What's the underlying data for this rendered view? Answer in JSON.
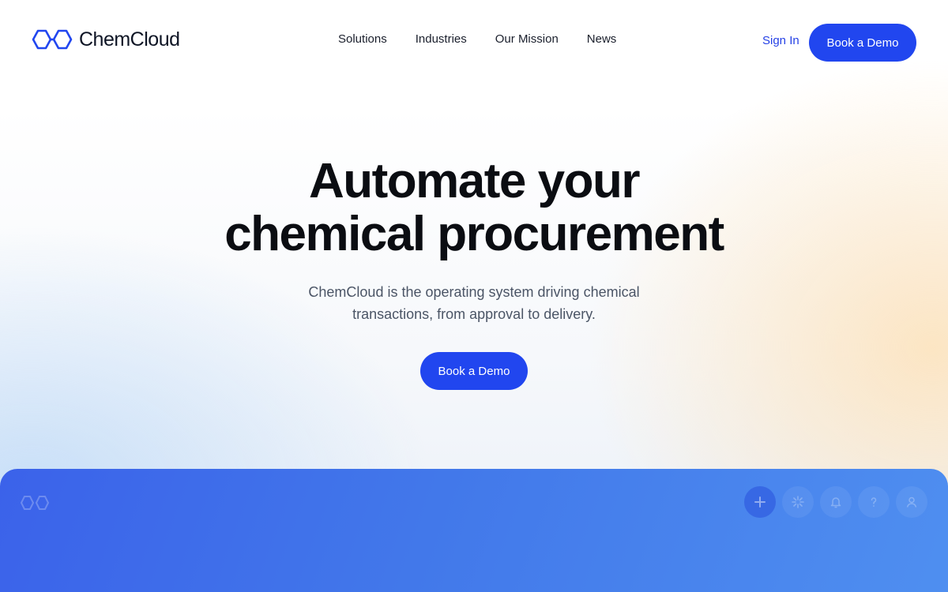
{
  "brand": {
    "name": "ChemCloud",
    "logo_icon": "hexagon-pair-icon",
    "accent_color": "#2146ef"
  },
  "nav": {
    "items": [
      {
        "label": "Solutions"
      },
      {
        "label": "Industries"
      },
      {
        "label": "Our Mission"
      },
      {
        "label": "News"
      }
    ],
    "sign_in_label": "Sign In",
    "cta_label": "Book a Demo"
  },
  "hero": {
    "title_line_1": "Automate your",
    "title_line_2": "chemical procurement",
    "subtitle": "ChemCloud is the operating system driving chemical transactions, from approval to delivery.",
    "cta_label": "Book a Demo"
  },
  "preview": {
    "toolbar_icons": [
      "plus-icon",
      "sparkle-icon",
      "bell-icon",
      "help-icon",
      "user-icon"
    ]
  }
}
